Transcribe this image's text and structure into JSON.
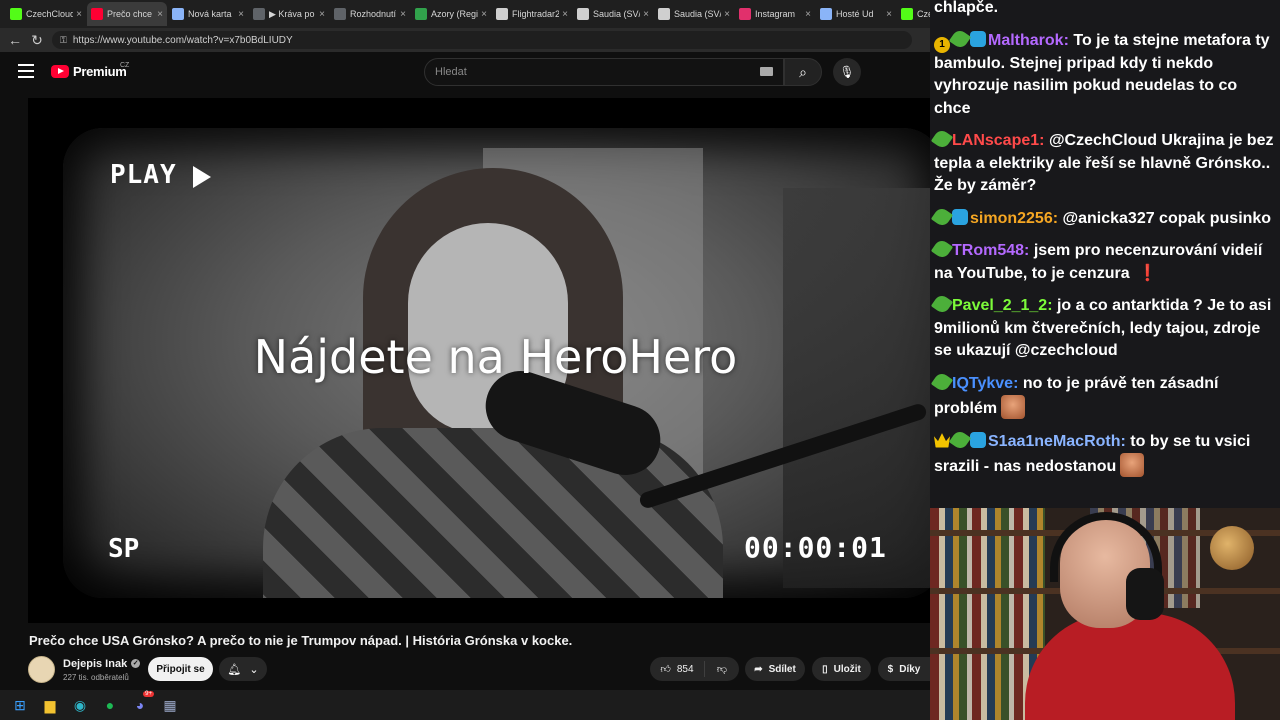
{
  "browser": {
    "tabs": [
      {
        "label": "CzechCloud",
        "color": "#53fc18",
        "active": false
      },
      {
        "label": "Prečo chce",
        "color": "#ff0033",
        "active": true
      },
      {
        "label": "Nová karta",
        "color": "#8ab4f8",
        "active": false
      },
      {
        "label": "▶ Kráva po",
        "color": "#5f6368",
        "active": false
      },
      {
        "label": "Rozhodnutí",
        "color": "#5f6368",
        "active": false
      },
      {
        "label": "Azory (Regi",
        "color": "#31a24c",
        "active": false
      },
      {
        "label": "Flightradar2",
        "color": "#cfcfcf",
        "active": false
      },
      {
        "label": "Saudia (SV/",
        "color": "#cfcfcf",
        "active": false
      },
      {
        "label": "Saudia (SV/",
        "color": "#cfcfcf",
        "active": false
      },
      {
        "label": "Instagram",
        "color": "#e1306c",
        "active": false
      },
      {
        "label": "Hosté Ud",
        "color": "#8ab4f8",
        "active": false
      },
      {
        "label": "Cze",
        "color": "#53fc18",
        "active": false
      }
    ],
    "url": "https://www.youtube.com/watch?v=x7b0BdLIUDY"
  },
  "youtube": {
    "brand": "Premium",
    "country": "CZ",
    "search_placeholder": "Hledat",
    "video": {
      "overlay_play": "PLAY",
      "caption": "Nájdete na HeroHero",
      "overlay_sp": "SP",
      "overlay_time": "00:00:01"
    },
    "title": "Prečo chce USA Grónsko? A prečo to nie je Trumpov nápad. | História Grónska v kocke.",
    "channel": {
      "name": "Dejepis Inak",
      "subs": "227 tis. odběratelů"
    },
    "join_label": "Připojit se",
    "likes": "854",
    "share_label": "Sdílet",
    "save_label": "Uložit",
    "thanks_label": "Díky"
  },
  "chat": {
    "messages": [
      {
        "badges": [],
        "user": "",
        "color": "#ffffff",
        "text": "chlapče.",
        "emote": false,
        "suffix": ""
      },
      {
        "badges": [
          "gold",
          "green",
          "cube"
        ],
        "user": "Maltharok",
        "color": "#b469ff",
        "text": "To je ta stejne metafora ty bambulo. Stejnej pripad kdy ti nekdo vyhrozuje nasilim pokud neudelas to co chce",
        "emote": false,
        "suffix": ""
      },
      {
        "badges": [
          "green"
        ],
        "user": "LANscape1",
        "color": "#ff4a4a",
        "text": "@CzechCloud Ukrajina je bez tepla a elektriky ale řeší se hlavně Grónsko.. Že by záměr?",
        "emote": false,
        "suffix": ""
      },
      {
        "badges": [
          "green",
          "cube"
        ],
        "user": "simon2256",
        "color": "#f5a623",
        "text": "@anicka327 copak pusinko",
        "emote": false,
        "suffix": ""
      },
      {
        "badges": [
          "green"
        ],
        "user": "TRom548",
        "color": "#b469ff",
        "text": "jsem pro necenzurování videií na YouTube, to je cenzura",
        "emote": false,
        "suffix": "❗"
      },
      {
        "badges": [
          "green"
        ],
        "user": "Pavel_2_1_2",
        "color": "#7cfc3a",
        "text": "jo a co antarktida ? Je to asi 9milionů km čtverečních, ledy tajou, zdroje se ukazují @czechcloud",
        "emote": false,
        "suffix": ""
      },
      {
        "badges": [
          "green"
        ],
        "user": "IQTykve",
        "color": "#4a90ff",
        "text": "no to je právě ten zásadní problém",
        "emote": true,
        "suffix": ""
      },
      {
        "badges": [
          "crown",
          "green",
          "cube"
        ],
        "user": "S1aa1neMacRoth",
        "color": "#8ab4ff",
        "text": "to by se tu vsici srazili - nas nedostanou",
        "emote": true,
        "suffix": ""
      }
    ]
  },
  "taskbar": {
    "items": [
      {
        "name": "windows-start-icon",
        "glyph": "⊞",
        "color": "#3aa0ff"
      },
      {
        "name": "file-explorer-icon",
        "glyph": "▆",
        "color": "#f2c230"
      },
      {
        "name": "edge-browser-icon",
        "glyph": "◉",
        "color": "#2fb5c8"
      },
      {
        "name": "spotify-icon",
        "glyph": "●",
        "color": "#1db954"
      },
      {
        "name": "discord-icon",
        "glyph": "◕",
        "color": "#7b85f3"
      },
      {
        "name": "calculator-icon",
        "glyph": "▦",
        "color": "#9aa7c7"
      }
    ],
    "discord_badge": "9+"
  }
}
